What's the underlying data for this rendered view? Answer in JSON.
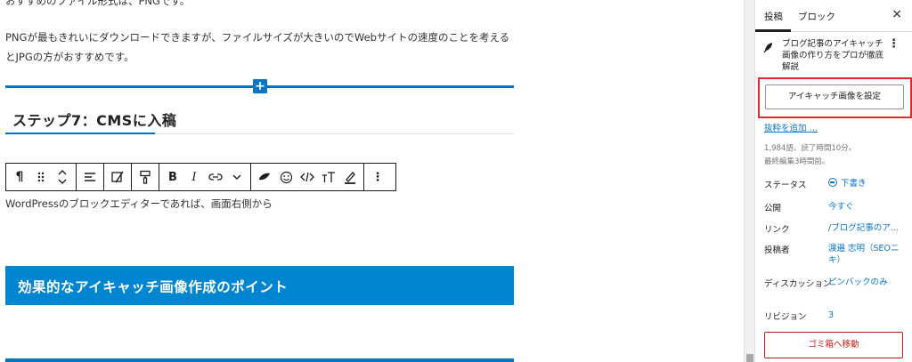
{
  "editor": {
    "para_top": "おすすめのファイル形式は、PNGです。",
    "para_png": "PNGが最もきれいにダウンロードできますが、ファイルサイズが大きいのでWebサイトの速度のことを考えるとJPGの方がおすすめです。",
    "insert_symbol": "+",
    "heading3": "ステップ7：CMSに入稿",
    "para_wp": "WordPressのブロックエディターであれば、画面右側から",
    "heading2": "効果的なアイキャッチ画像作成のポイント",
    "toolbar": {
      "paragraph": "¶",
      "bold": "B",
      "italic": "I",
      "more": "⋮"
    }
  },
  "sidebar": {
    "tabs": {
      "post": "投稿",
      "block": "ブロック"
    },
    "close": "×",
    "doc_title": "ブログ記事のアイキャッチ画像の作り方をプロが徹底解説",
    "kebab": "⋮",
    "featured_image_button": "アイキャッチ画像を設定",
    "excerpt_link": "抜粋を追加 …",
    "meta_words": "1,984語、読了時間10分。",
    "meta_edited": "最終編集3時間前。",
    "rows": {
      "status": {
        "label": "ステータス",
        "value": "下書き"
      },
      "publish": {
        "label": "公開",
        "value": "今すぐ"
      },
      "link": {
        "label": "リンク",
        "value": "/ブログ記事のア..."
      },
      "author": {
        "label": "投稿者",
        "value": "渡邉 志明（SEOニキ）"
      },
      "discussion": {
        "label": "ディスカッション",
        "value": "ピンバックのみ"
      },
      "revisions": {
        "label": "リビジョン",
        "value": "3"
      }
    },
    "trash_button": "ゴミ箱へ移動"
  },
  "colors": {
    "accent_blue": "#0176c0",
    "heading_box": "#0085d0",
    "link_blue": "#0b74c4",
    "highlight_red": "#e8262c",
    "danger_red": "#cc1818"
  }
}
